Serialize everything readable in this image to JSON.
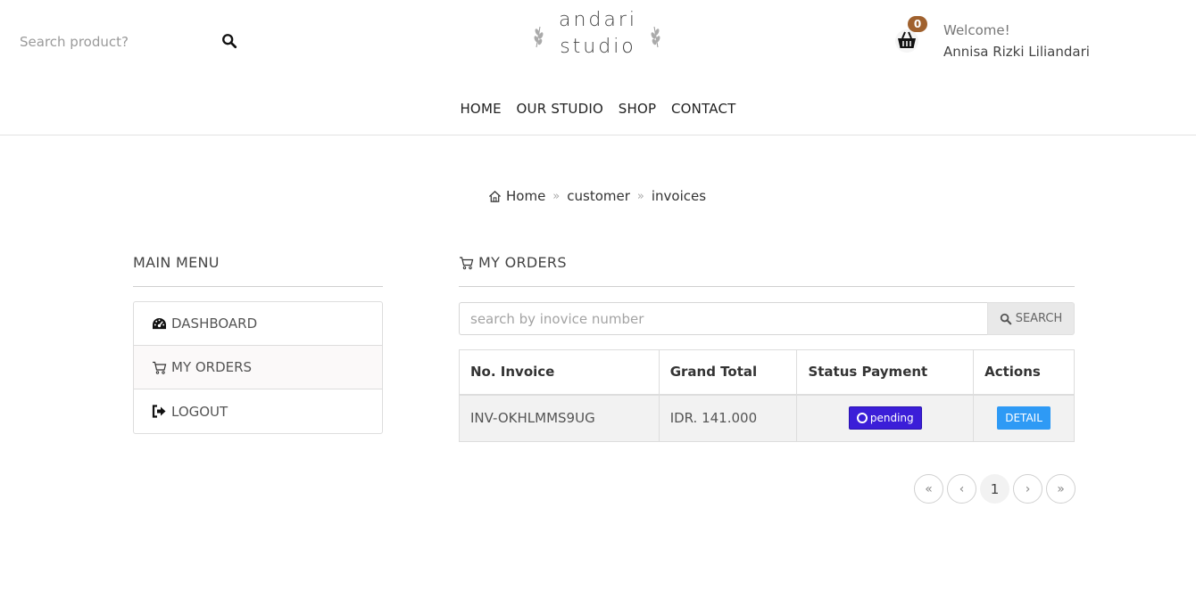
{
  "header": {
    "search_placeholder": "Search product?",
    "logo_line1": "andari",
    "logo_line2": "studio",
    "cart_count": "0",
    "welcome": "Welcome!",
    "username": "Annisa Rizki Liliandari"
  },
  "nav": [
    "HOME",
    "OUR STUDIO",
    "SHOP",
    "CONTACT"
  ],
  "breadcrumb": {
    "home": "Home",
    "sep1": "»",
    "level2": "customer",
    "sep2": "»",
    "level3": "invoices"
  },
  "sidebar": {
    "title": "MAIN MENU",
    "items": [
      {
        "label": "DASHBOARD",
        "icon": "dashboard-icon"
      },
      {
        "label": "MY ORDERS",
        "icon": "cart-icon"
      },
      {
        "label": "LOGOUT",
        "icon": "sign-out-icon"
      }
    ]
  },
  "main": {
    "title": "MY ORDERS",
    "search_placeholder": "search by inovice number",
    "search_button": "SEARCH",
    "table": {
      "headers": [
        "No. Invoice",
        "Grand Total",
        "Status Payment",
        "Actions"
      ],
      "rows": [
        {
          "invoice": "INV-OKHLMMS9UG",
          "total": "IDR. 141.000",
          "status": "pending",
          "action": "DETAIL"
        }
      ]
    },
    "pagination": {
      "first": "«",
      "prev": "‹",
      "current": "1",
      "next": "›",
      "last": "»"
    }
  },
  "colors": {
    "cart_badge": "#a0612e",
    "pending_badge": "#3b1ed8",
    "detail_button": "#2e9af5"
  }
}
